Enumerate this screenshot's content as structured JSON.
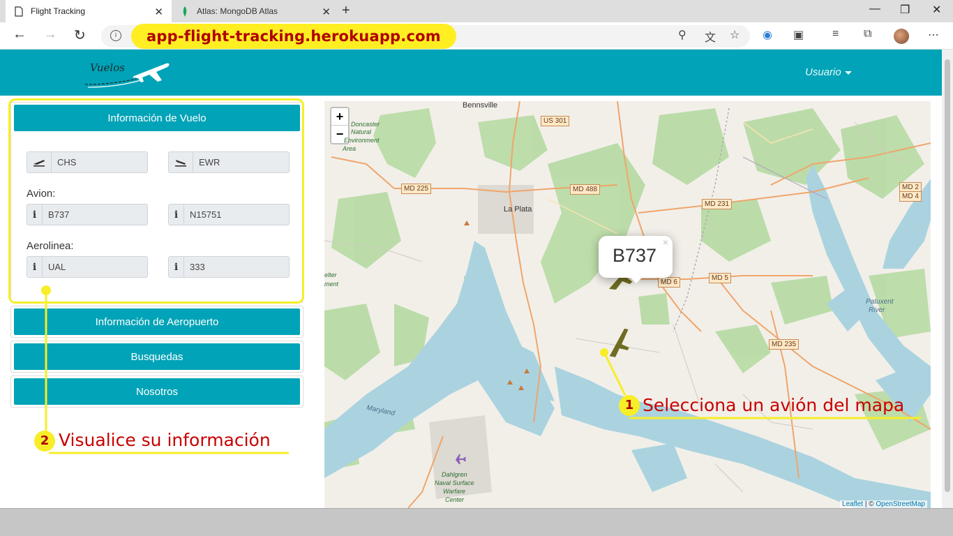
{
  "browser": {
    "tabs": [
      {
        "title": "Flight Tracking",
        "active": true
      },
      {
        "title": "Atlas: MongoDB Atlas",
        "active": false
      }
    ],
    "url": "app-flight-tracking.herokuapp.com"
  },
  "header": {
    "brand": "Vuelos",
    "user_menu": "Usuario",
    "color": "#00a3b7"
  },
  "sidebar": {
    "flight_info_button": "Información de Vuelo",
    "departure_airport": "CHS",
    "arrival_airport": "EWR",
    "avion_label": "Avion:",
    "aircraft_type": "B737",
    "registration": "N15751",
    "aerolinea_label": "Aerolinea:",
    "airline": "UAL",
    "flight_number": "333",
    "airport_info_button": "Información de Aeropuerto",
    "search_button": "Busquedas",
    "about_button": "Nosotros"
  },
  "map": {
    "zoom_in": "+",
    "zoom_out": "−",
    "popup_text": "B737",
    "popup_close": "×",
    "attribution_leaflet": "Leaflet",
    "attribution_sep": " | © ",
    "attribution_osm": "OpenStreetMap",
    "road_labels": {
      "us301": "US 301",
      "md225": "MD 225",
      "md488": "MD 488",
      "md231": "MD 231",
      "md2": "MD 2",
      "md4": "MD 4",
      "md6": "MD 6",
      "md5": "MD 5",
      "md235": "MD 235"
    },
    "place_labels": {
      "bennsville": "Bennsville",
      "laplata": "La Plata",
      "patuxent1": "Patuxent",
      "patuxent2": "River",
      "maryland": "Maryland",
      "dahlgren1": "Dahlgren",
      "dahlgren2": "Naval Surface",
      "dahlgren3": "Warfare",
      "dahlgren4": "Center",
      "park1": "Doncaster",
      "park2": "Natural",
      "park3": "Environment",
      "park4": "Area",
      "shelter1": "elter",
      "shelter2": "ment"
    }
  },
  "annotations": {
    "step1_num": "1",
    "step1_text": "Selecciona un avión del mapa",
    "step2_num": "2",
    "step2_text": "Visualice su información",
    "highlight_color": "#f7ee28",
    "text_color": "#c80000"
  }
}
